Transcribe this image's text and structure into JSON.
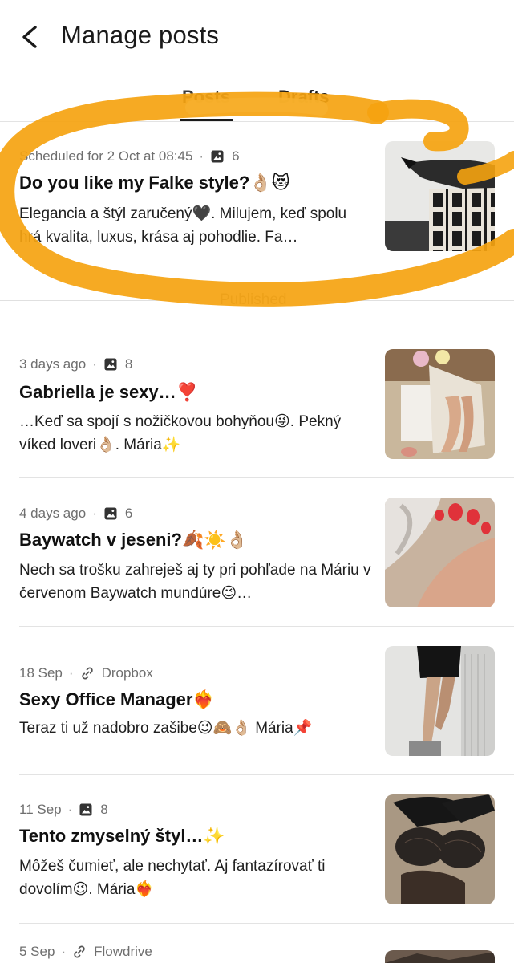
{
  "header": {
    "title": "Manage posts"
  },
  "tabs": [
    {
      "label": "Posts"
    },
    {
      "label": "Drafts"
    }
  ],
  "scheduled": {
    "meta": "Scheduled for 2 Oct at 08:45",
    "count": "6",
    "title": "Do you like my Falke style?👌🏼😻",
    "body": "Elegancia a štýl zaručený🖤. Milujem, keď spolu hrá kvalita, luxus, krása aj pohodlie. Fa…"
  },
  "section_published": "Published",
  "posts": [
    {
      "meta": "3 days ago",
      "attachment_type": "image",
      "attachment": "8",
      "title": "Gabriella je sexy…❣️",
      "body": "…Keď sa spojí s nožičkovou bohyňou😜. Pekný víked loveri👌🏼. Mária✨"
    },
    {
      "meta": "4 days ago",
      "attachment_type": "image",
      "attachment": "6",
      "title": "Baywatch v jeseni?🍂☀️👌🏼",
      "body": "Nech sa trošku zahreješ aj ty pri pohľade na Máriu v červenom Baywatch mundúre😉…"
    },
    {
      "meta": "18 Sep",
      "attachment_type": "link",
      "attachment": "Dropbox",
      "title": "Sexy Office Manager❤️‍🔥",
      "body": "Teraz ti už nadobro zašibe😉🙈👌🏼 Mária📌"
    },
    {
      "meta": "11 Sep",
      "attachment_type": "image",
      "attachment": "8",
      "title": "Tento zmyselný štyl…✨",
      "body": "Môžeš čumieť, ale nechytať. Aj fantazírovať ti dovolím😉. Mária❤️‍🔥"
    },
    {
      "meta": "5 Sep",
      "attachment_type": "link",
      "attachment": "Flowdrive",
      "title": "",
      "body": ""
    }
  ],
  "icons": {
    "back": "chevron-left-icon",
    "image": "image-icon",
    "link": "link-icon"
  },
  "colors": {
    "highlight": "#F5A310",
    "text": "#1a1a1a",
    "muted": "#6f6f6f"
  }
}
